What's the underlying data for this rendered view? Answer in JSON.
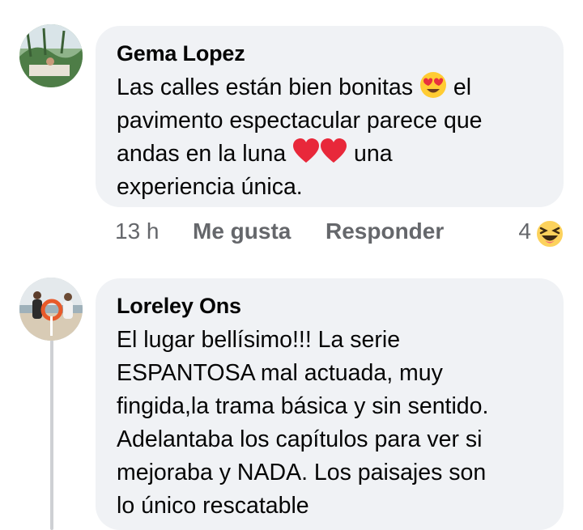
{
  "comments": [
    {
      "author": "Gema Lopez",
      "lines": [
        "Las calles están bien bonitas",
        "el",
        "pavimento espectacular parece que",
        "andas en la luna",
        "una",
        "experiencia única."
      ],
      "emojis": [
        "heart-eyes-emoji",
        "red-heart-emoji",
        "red-heart-emoji"
      ],
      "timestamp": "13 h",
      "like_label": "Me gusta",
      "reply_label": "Responder",
      "reaction_count": "4",
      "reaction_icon": "haha-reaction-icon"
    },
    {
      "author": "Loreley Ons",
      "lines": [
        "El lugar bellísimo!!! La serie",
        "ESPANTOSA mal actuada, muy",
        "fingida,la trama básica y sin sentido.",
        "Adelantaba los capítulos para ver si",
        "mejoraba y NADA. Los paisajes son",
        "lo único rescatable"
      ]
    }
  ],
  "colors": {
    "bubble": "#f0f2f5",
    "text": "#050505",
    "secondary": "#65676b",
    "thread_line": "#ced0d4"
  }
}
